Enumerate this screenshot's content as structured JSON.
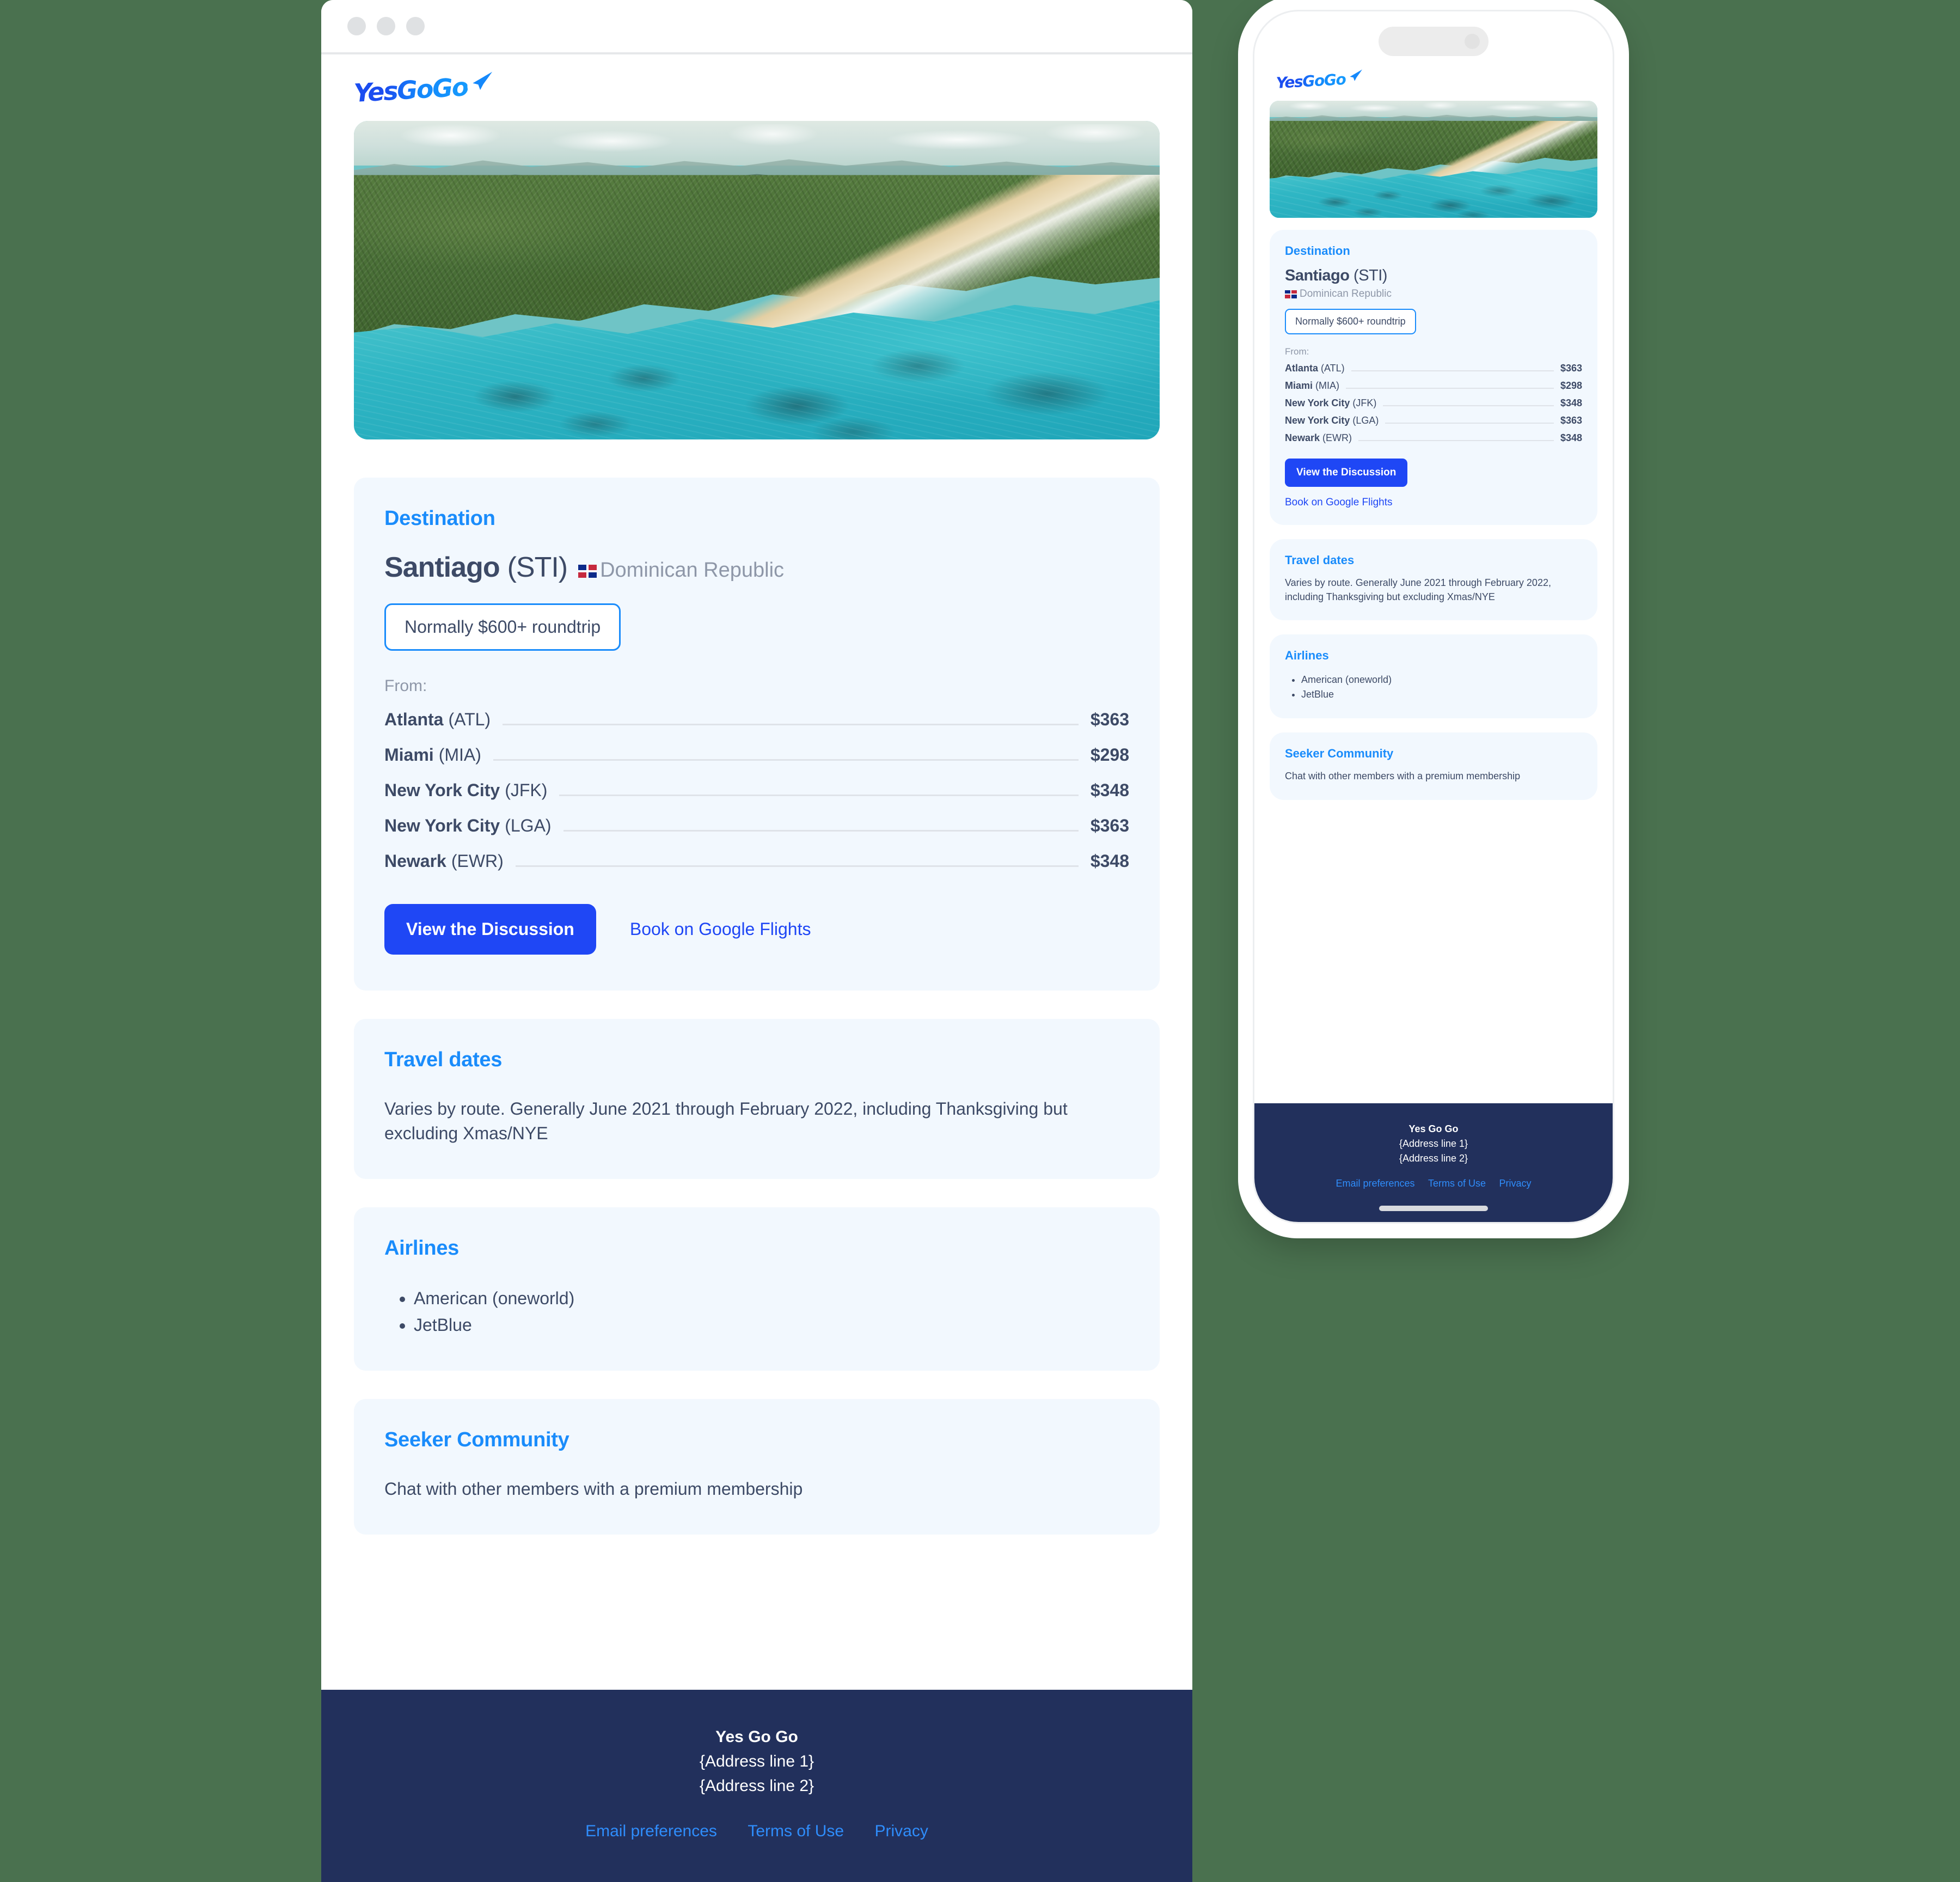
{
  "brand": {
    "logo_text": "YesGoGo",
    "logo_icon": "paper-plane-icon"
  },
  "window_controls": [
    "close-dot",
    "minimize-dot",
    "maximize-dot"
  ],
  "hero": {
    "alt": "aerial tropical coastline with turquoise water"
  },
  "destination": {
    "section_title": "Destination",
    "city": "Santiago",
    "airport_code": "(STI)",
    "country": "Dominican Republic",
    "country_flag": "dominican-republic-flag-icon",
    "price_note": "Normally $600+ roundtrip",
    "from_label": "From:",
    "routes": [
      {
        "city": "Atlanta",
        "code": "(ATL)",
        "price": "$363"
      },
      {
        "city": "Miami",
        "code": "(MIA)",
        "price": "$298"
      },
      {
        "city": "New York City",
        "code": "(JFK)",
        "price": "$348"
      },
      {
        "city": "New York City",
        "code": "(LGA)",
        "price": "$363"
      },
      {
        "city": "Newark",
        "code": "(EWR)",
        "price": "$348"
      }
    ],
    "primary_button": "View the Discussion",
    "secondary_link": "Book on Google Flights"
  },
  "travel_dates": {
    "section_title": "Travel dates",
    "body": "Varies by route. Generally June 2021 through February 2022, including Thanksgiving but excluding Xmas/NYE"
  },
  "airlines": {
    "section_title": "Airlines",
    "items": [
      "American (oneworld)",
      "JetBlue"
    ]
  },
  "seeker_community": {
    "section_title": "Seeker Community",
    "body": "Chat with other members with a premium membership"
  },
  "footer": {
    "brand": "Yes Go Go",
    "address_line_1": "{Address line 1}",
    "address_line_2": "{Address line 2}",
    "links": [
      "Email preferences",
      "Terms of Use",
      "Privacy"
    ]
  },
  "colors": {
    "page_background": "#4a714f",
    "card_background": "#f2f8fe",
    "accent_blue": "#1a8cfb",
    "button_blue": "#1f47f5",
    "text_navy": "#3d4a66",
    "muted_gray": "#8e97a8",
    "footer_navy": "#22305c"
  }
}
